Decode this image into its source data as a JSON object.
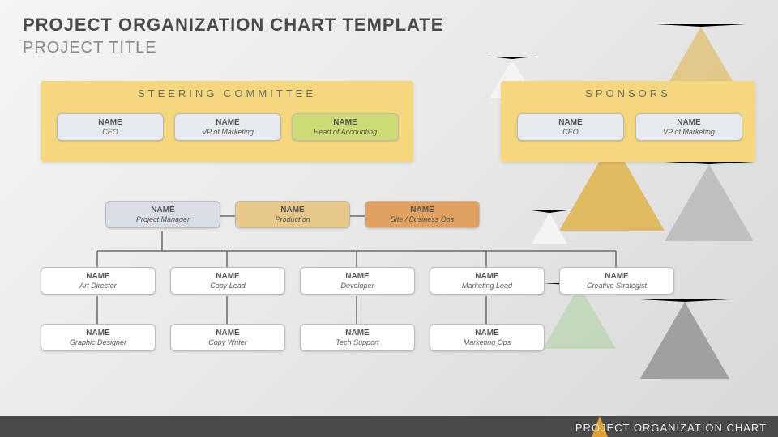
{
  "header": {
    "title": "PROJECT ORGANIZATION CHART TEMPLATE",
    "subtitle": "PROJECT TITLE"
  },
  "steering": {
    "title": "STEERING COMMITTEE",
    "members": [
      {
        "name": "NAME",
        "role": "CEO"
      },
      {
        "name": "NAME",
        "role": "VP of Marketing"
      },
      {
        "name": "NAME",
        "role": "Head of Accounting"
      }
    ]
  },
  "sponsors": {
    "title": "SPONSORS",
    "members": [
      {
        "name": "NAME",
        "role": "CEO"
      },
      {
        "name": "NAME",
        "role": "VP of Marketing"
      }
    ]
  },
  "tier1": [
    {
      "name": "NAME",
      "role": "Project Manager"
    },
    {
      "name": "NAME",
      "role": "Production"
    },
    {
      "name": "NAME",
      "role": "Site / Business Ops"
    }
  ],
  "tier2": [
    {
      "name": "NAME",
      "role": "Art Director"
    },
    {
      "name": "NAME",
      "role": "Copy Lead"
    },
    {
      "name": "NAME",
      "role": "Developer"
    },
    {
      "name": "NAME",
      "role": "Marketing Lead"
    },
    {
      "name": "NAME",
      "role": "Creative Strategist"
    }
  ],
  "tier3": [
    {
      "name": "NAME",
      "role": "Graphic Designer"
    },
    {
      "name": "NAME",
      "role": "Copy Writer"
    },
    {
      "name": "NAME",
      "role": "Tech Support"
    },
    {
      "name": "NAME",
      "role": "Marketing Ops"
    }
  ],
  "footer": {
    "text": "PROJECT ORGANIZATION CHART"
  },
  "colors": {
    "chip_gray": "#e6e9ee",
    "chip_green": "#cddb74",
    "chip_tan": "#e6c88b",
    "chip_orange": "#e0a060",
    "chip_white": "#ffffff"
  }
}
